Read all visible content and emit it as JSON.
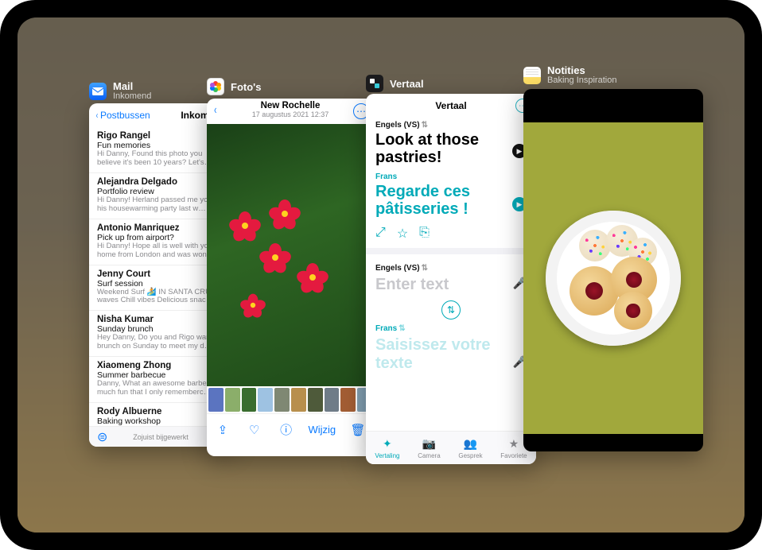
{
  "apps": {
    "mail": {
      "name": "Mail",
      "subtitle": "Inkomend",
      "back_label": "Postbussen",
      "inbox_label": "Inkomend",
      "footer_status": "Zojuist bijgewerkt",
      "items": [
        {
          "sender": "Rigo Rangel",
          "subject": "Fun memories",
          "preview": "Hi Danny, Found this photo you believe it's been 10 years? Let's…"
        },
        {
          "sender": "Alejandra Delgado",
          "subject": "Portfolio review",
          "preview": "Hi Danny! Herland passed me yo at his housewarming party last w…"
        },
        {
          "sender": "Antonio Manriquez",
          "subject": "Pick up from airport?",
          "preview": "Hi Danny! Hope all is well with yo home from London and was won…"
        },
        {
          "sender": "Jenny Court",
          "subject": "Surf session",
          "preview": "Weekend Surf 🏄 IN SANTA CRU waves Chill vibes Delicious snac…"
        },
        {
          "sender": "Nisha Kumar",
          "subject": "Sunday brunch",
          "preview": "Hey Danny, Do you and Rigo wan brunch on Sunday to meet my d…"
        },
        {
          "sender": "Xiaomeng Zhong",
          "subject": "Summer barbecue",
          "preview": "Danny, What an awesome barbec much fun that I only rememberc…"
        },
        {
          "sender": "Rody Albuerne",
          "subject": "Baking workshop",
          "preview": ""
        }
      ]
    },
    "photos": {
      "name": "Foto's",
      "location": "New Rochelle",
      "date": "17 augustus 2021 12:37",
      "edit_label": "Wijzig"
    },
    "translate": {
      "name": "Vertaal",
      "title": "Vertaal",
      "source_lang": "Engels (VS)",
      "source_text": "Look at those pastries!",
      "target_lang": "Frans",
      "target_text": "Regarde ces pâtisseries !",
      "input_lang": "Engels (VS)",
      "input_placeholder": "Enter text",
      "output_lang": "Frans",
      "output_placeholder": "Saisissez votre texte",
      "tabs": {
        "translate": "Vertaling",
        "camera": "Camera",
        "conversation": "Gesprek",
        "favorites": "Favoriete"
      }
    },
    "notes": {
      "name": "Notities",
      "subtitle": "Baking Inspiration"
    }
  },
  "icons": {
    "chevron_left": "‹",
    "ellipsis": "⋯",
    "play": "▶",
    "expand": "⤢",
    "star": "☆",
    "copy": "⎘",
    "mic": "🎤",
    "swap": "⇅",
    "share": "⇪",
    "heart": "♡",
    "info": "ⓘ",
    "trash": "🗑",
    "compose": "✎",
    "filter": "⊜",
    "camera": "📷",
    "people": "👥",
    "star_filled": "★",
    "translate_tab": "✦"
  }
}
